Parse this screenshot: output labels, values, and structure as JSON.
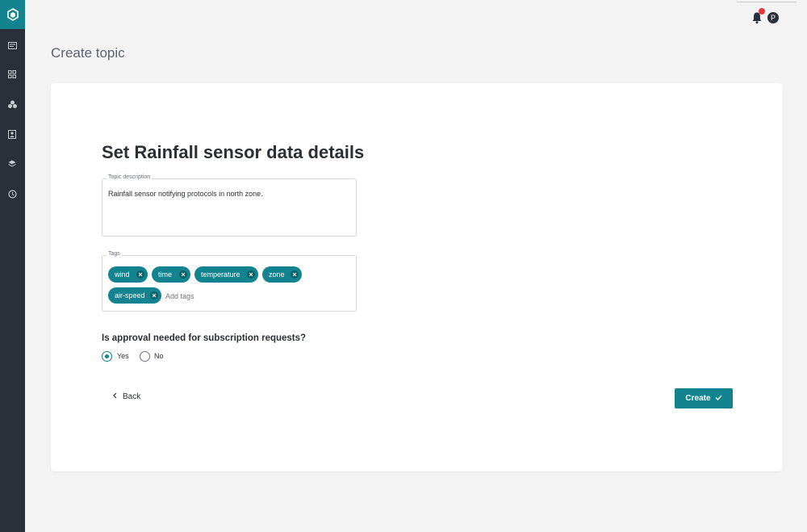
{
  "sidebar": {
    "logo_icon": "app-logo-icon",
    "items": [
      {
        "icon": "catalog-icon"
      },
      {
        "icon": "grid-icon"
      },
      {
        "icon": "cluster-icon"
      },
      {
        "icon": "contacts-icon"
      },
      {
        "icon": "layers-icon"
      },
      {
        "icon": "clock-icon"
      }
    ]
  },
  "header": {
    "notification_icon": "bell-icon",
    "avatar_initial": "P"
  },
  "page": {
    "title": "Create topic"
  },
  "form": {
    "heading": "Set Rainfall sensor data details",
    "description": {
      "label": "Topic description",
      "value": "Rainfall sensor notifying protocols in north zone."
    },
    "tags": {
      "label": "Tags",
      "items": [
        "wind",
        "time",
        "temperature",
        "zone",
        "air-speed"
      ],
      "placeholder": "Add tags"
    },
    "approval": {
      "question": "Is approval needed for subscription requests?",
      "options": [
        "Yes",
        "No"
      ],
      "selected": "Yes"
    },
    "back_label": "Back",
    "create_label": "Create"
  },
  "colors": {
    "accent": "#12838f",
    "sidebar": "#2a2f3a",
    "notification_dot": "#e0393e"
  }
}
